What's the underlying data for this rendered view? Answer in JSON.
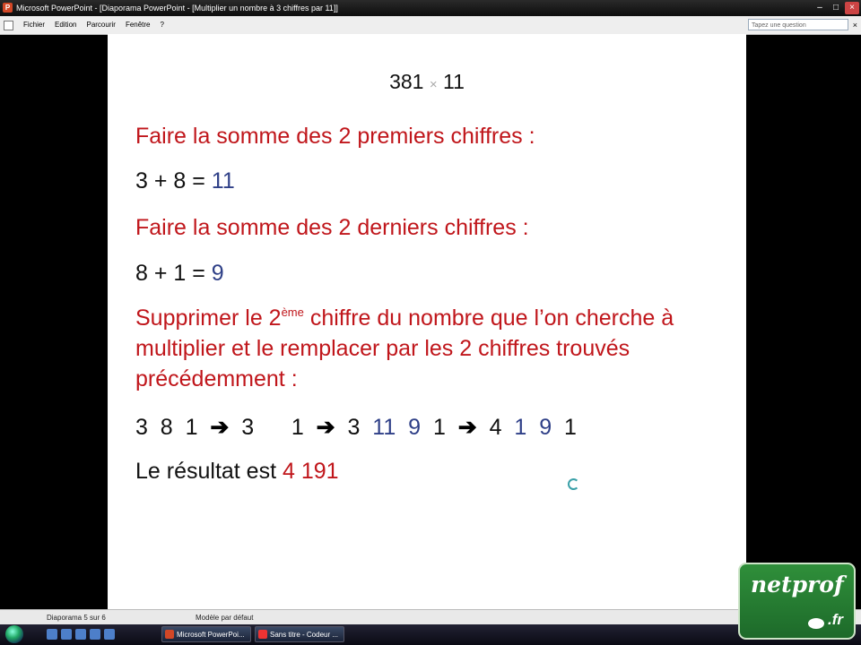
{
  "window": {
    "title": "Microsoft PowerPoint - [Diaporama PowerPoint - [Multiplier un nombre à 3 chiffres par 11]]"
  },
  "menu": {
    "items": [
      "Fichier",
      "Edition",
      "Parcourir",
      "Fenêtre",
      "?"
    ],
    "help_placeholder": "Tapez une question",
    "close_glyph": "×"
  },
  "slide": {
    "heading_left": "381",
    "heading_times": "×",
    "heading_right": "11",
    "step1": "Faire la somme des 2 premiers chiffres :",
    "calc1_prefix": "3 + 8 = ",
    "calc1_result": "11",
    "step2": "Faire la somme des 2 derniers chiffres :",
    "calc2_prefix": "8 + 1 = ",
    "calc2_result": "9",
    "step3_part1": "Supprimer le 2",
    "step3_sup": "ème",
    "step3_part2": " chiffre du nombre que l’on cherche à",
    "step3_line2": "multiplier et le remplacer par les 2 chiffres trouvés",
    "step3_line3": "précédemment :",
    "seq": {
      "a": "3  8  1",
      "b": "3",
      "c": "1",
      "d1": "3",
      "d2": "11",
      "d3": "9",
      "d4": "1",
      "e1": "4",
      "e2": "1",
      "e3": "9",
      "e4": "1"
    },
    "result_prefix": "Le résultat est ",
    "result_value": "4 191"
  },
  "status": {
    "slide_counter": "Diaporama 5 sur 6",
    "template": "Modèle par défaut"
  },
  "taskbar": {
    "tasks": [
      "Microsoft PowerPoi...",
      "Sans titre - Codeur ..."
    ]
  },
  "badge": {
    "brand": "netprof",
    "tld": ".fr"
  },
  "colors": {
    "red_text": "#c0161b",
    "blue_digits": "#2e3f87",
    "badge_green": "#2f8f3a"
  }
}
